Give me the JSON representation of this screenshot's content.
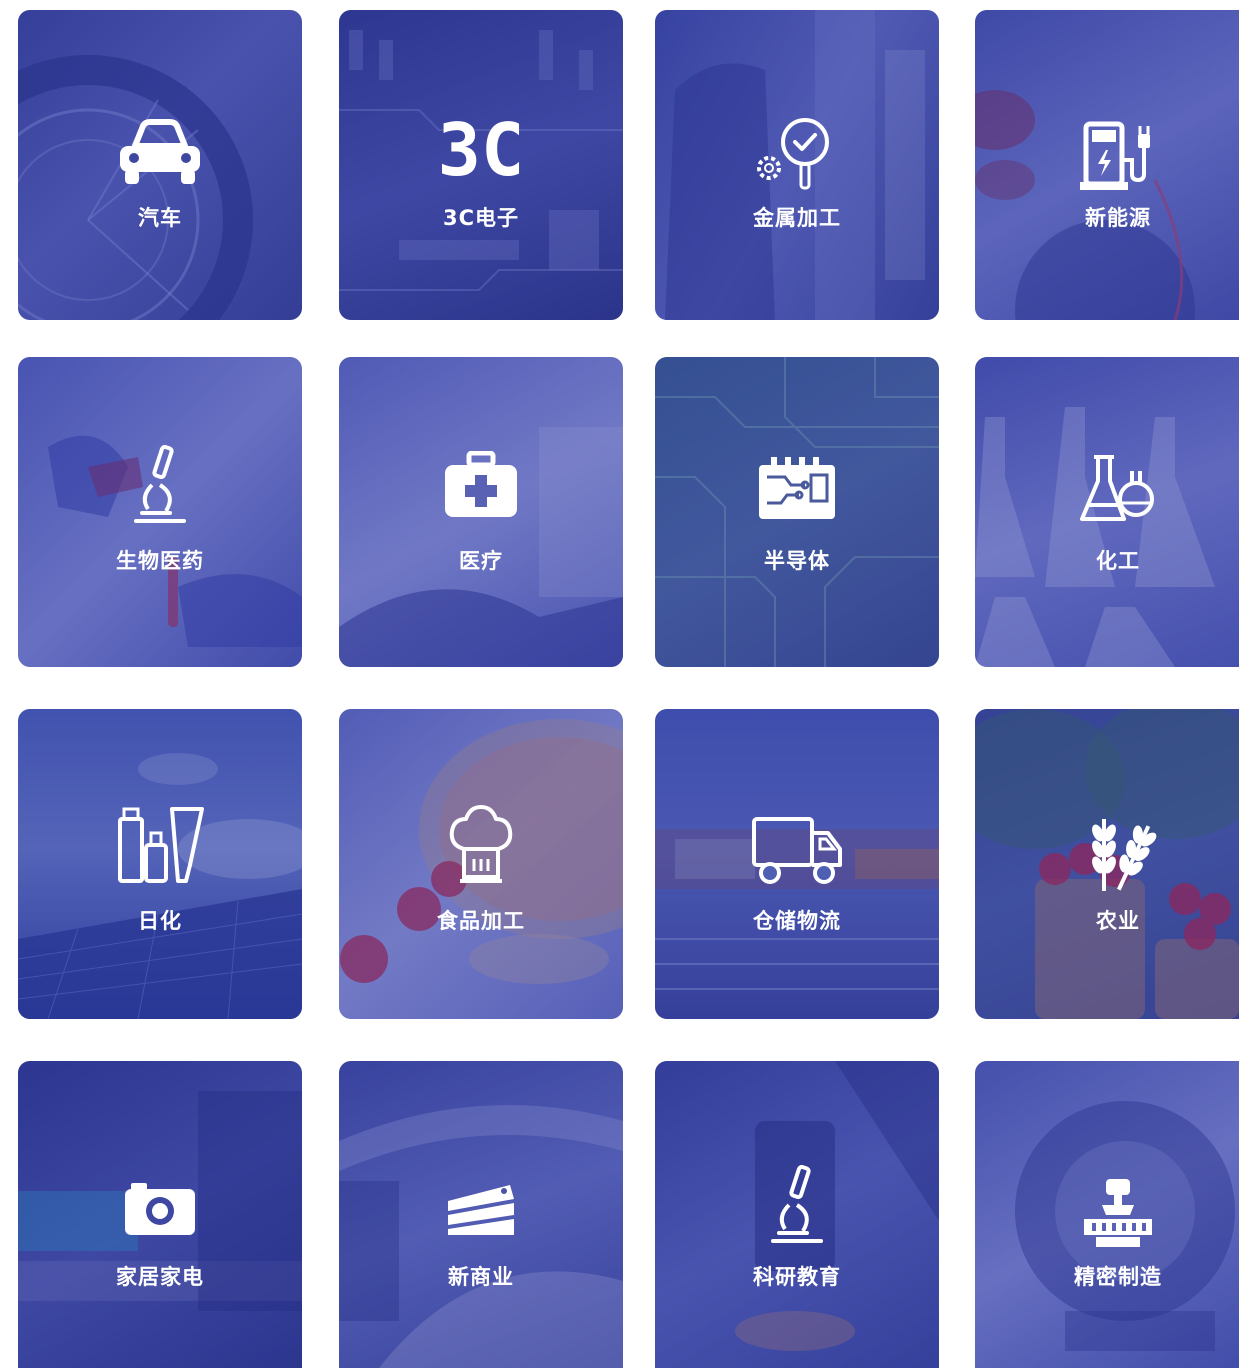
{
  "industries": [
    {
      "label": "汽车",
      "icon": "car-icon"
    },
    {
      "label": "3C电子",
      "icon": "3c-icon",
      "icon_text": "3C"
    },
    {
      "label": "金属加工",
      "icon": "magnifier-gear-icon"
    },
    {
      "label": "新能源",
      "icon": "charging-station-icon"
    },
    {
      "label": "生物医药",
      "icon": "microscope-icon"
    },
    {
      "label": "医疗",
      "icon": "medical-kit-icon"
    },
    {
      "label": "半导体",
      "icon": "circuit-board-icon"
    },
    {
      "label": "化工",
      "icon": "flask-icon"
    },
    {
      "label": "日化",
      "icon": "cosmetics-icon"
    },
    {
      "label": "食品加工",
      "icon": "chef-hat-icon"
    },
    {
      "label": "仓储物流",
      "icon": "truck-icon"
    },
    {
      "label": "农业",
      "icon": "wheat-icon"
    },
    {
      "label": "家居家电",
      "icon": "camera-icon"
    },
    {
      "label": "新商业",
      "icon": "cake-icon"
    },
    {
      "label": "科研教育",
      "icon": "microscope-icon"
    },
    {
      "label": "精密制造",
      "icon": "robot-arm-icon"
    }
  ],
  "colors": {
    "overlay": "#2c36a0",
    "text": "#ffffff"
  }
}
